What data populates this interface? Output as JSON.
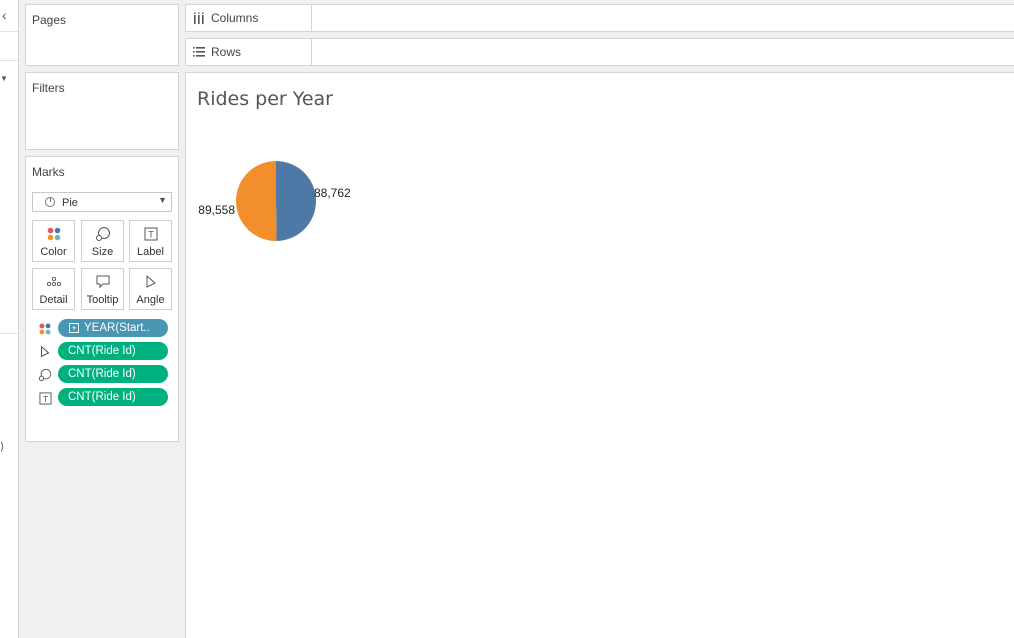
{
  "shelves": {
    "pages": "Pages",
    "filters": "Filters",
    "marks": "Marks",
    "columns": "Columns",
    "rows": "Rows"
  },
  "marks_card": {
    "mark_type": "Pie",
    "buttons": [
      "Color",
      "Size",
      "Label",
      "Detail",
      "Tooltip",
      "Angle"
    ],
    "fields": [
      {
        "encoding": "color",
        "label": "YEAR(Start..",
        "kind": "dimension"
      },
      {
        "encoding": "angle",
        "label": "CNT(Ride Id)",
        "kind": "measure"
      },
      {
        "encoding": "size",
        "label": "CNT(Ride Id)",
        "kind": "measure"
      },
      {
        "encoding": "label",
        "label": "CNT(Ride Id)",
        "kind": "measure"
      }
    ]
  },
  "view": {
    "title": "Rides per Year"
  },
  "chart_data": {
    "type": "pie",
    "title": "Rides per Year",
    "slices": [
      {
        "value": 88762,
        "label": "88,762",
        "color": "#4e79a7"
      },
      {
        "value": 89558,
        "label": "89,558",
        "color": "#f28e2b"
      }
    ]
  },
  "colors": {
    "pill_measure": "#00b180",
    "pill_dimension": "#4996b2"
  }
}
